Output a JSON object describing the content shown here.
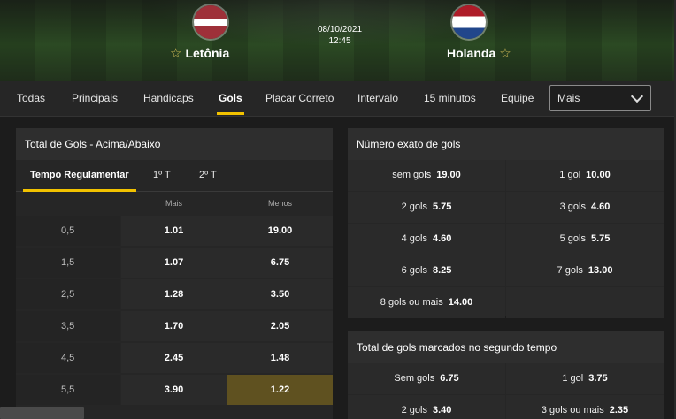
{
  "match": {
    "date": "08/10/2021",
    "time": "12:45",
    "home": {
      "name": "Letônia"
    },
    "away": {
      "name": "Holanda"
    }
  },
  "colors": {
    "accent": "#f2c200",
    "highlight": "#5f5120"
  },
  "tabs": [
    {
      "label": "Todas"
    },
    {
      "label": "Principais"
    },
    {
      "label": "Handicaps"
    },
    {
      "label": "Gols",
      "active": true
    },
    {
      "label": "Placar Correto"
    },
    {
      "label": "Intervalo"
    },
    {
      "label": "15 minutos"
    },
    {
      "label": "Equipe"
    }
  ],
  "more_select": {
    "value": "Mais"
  },
  "total_goals": {
    "title": "Total de Gols - Acima/Abaixo",
    "subtabs": [
      {
        "label": "Tempo Regulamentar",
        "active": true
      },
      {
        "label": "1º T"
      },
      {
        "label": "2º T"
      }
    ],
    "headers": {
      "over": "Mais",
      "under": "Menos"
    },
    "rows": [
      {
        "line": "0,5",
        "over": "1.01",
        "under": "19.00"
      },
      {
        "line": "1,5",
        "over": "1.07",
        "under": "6.75"
      },
      {
        "line": "2,5",
        "over": "1.28",
        "under": "3.50"
      },
      {
        "line": "3,5",
        "over": "1.70",
        "under": "2.05"
      },
      {
        "line": "4,5",
        "over": "2.45",
        "under": "1.48"
      },
      {
        "line": "5,5",
        "over": "3.90",
        "under": "1.22",
        "under_highlighted": true
      }
    ]
  },
  "exact_goals": {
    "title": "Número exato de gols",
    "cells": [
      {
        "label": "sem gols",
        "odd": "19.00"
      },
      {
        "label": "1 gol",
        "odd": "10.00"
      },
      {
        "label": "2 gols",
        "odd": "5.75"
      },
      {
        "label": "3 gols",
        "odd": "4.60"
      },
      {
        "label": "4 gols",
        "odd": "4.60"
      },
      {
        "label": "5 gols",
        "odd": "5.75"
      },
      {
        "label": "6 gols",
        "odd": "8.25"
      },
      {
        "label": "7 gols",
        "odd": "13.00"
      },
      {
        "label": "8 gols ou mais",
        "odd": "14.00"
      }
    ]
  },
  "second_half_goals": {
    "title": "Total de gols marcados no segundo tempo",
    "cells": [
      {
        "label": "Sem gols",
        "odd": "6.75"
      },
      {
        "label": "1 gol",
        "odd": "3.75"
      },
      {
        "label": "2 gols",
        "odd": "3.40"
      },
      {
        "label": "3 gols ou mais",
        "odd": "2.35"
      }
    ]
  }
}
